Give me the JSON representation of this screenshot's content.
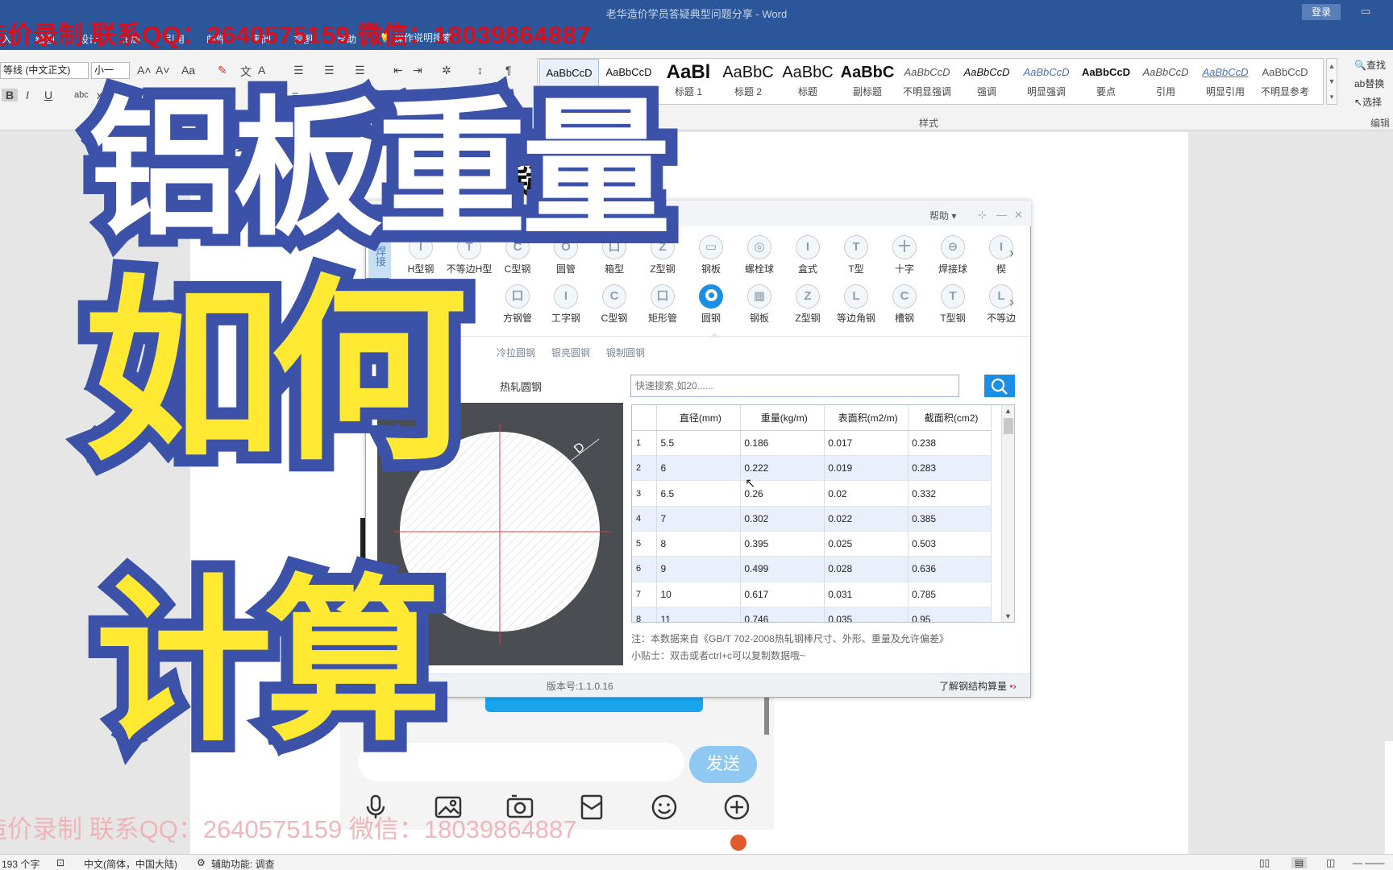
{
  "word": {
    "doc_title": "老华造价学员答疑典型问题分享  -  Word",
    "login": "登录",
    "tabs": [
      "入",
      "绘图",
      "设计",
      "布局",
      "引用",
      "邮件",
      "审阅",
      "视图",
      "帮助"
    ],
    "tell_me": "操作说明搜索",
    "font_name": "等线 (中文正文)",
    "font_size": "小一",
    "styles": [
      {
        "preview": "AaBbCcD",
        "name": "正文"
      },
      {
        "preview": "AaBbCcD",
        "name": "无间隔"
      },
      {
        "preview": "AaBl",
        "name": "标题 1"
      },
      {
        "preview": "AaBbC",
        "name": "标题 2"
      },
      {
        "preview": "AaBbC",
        "name": "标题"
      },
      {
        "preview": "AaBbC",
        "name": "副标题"
      },
      {
        "preview": "AaBbCcD",
        "name": "不明显强调"
      },
      {
        "preview": "AaBbCcD",
        "name": "强调"
      },
      {
        "preview": "AaBbCcD",
        "name": "明显强调"
      },
      {
        "preview": "AaBbCcD",
        "name": "要点"
      },
      {
        "preview": "AaBbCcD",
        "name": "引用"
      },
      {
        "preview": "AaBbCcD",
        "name": "明显引用"
      },
      {
        "preview": "AaBbCcD",
        "name": "不明显参考"
      }
    ],
    "styles_label": "样式",
    "find": "查找",
    "replace": "替换",
    "select": "选择",
    "edit_label": "编辑",
    "page_heading": "造 疑",
    "status": {
      "word_count": "193 个字",
      "language": "中文(简体，中国大陆)",
      "accessibility": "辅助功能: 调查"
    }
  },
  "watermark": {
    "top": "造价录制 联系QQ：2640575159 微信：18039864887",
    "bottom": "造价录制 联系QQ：2640575159 微信：18039864887"
  },
  "overlay": {
    "line1": "铝板重量",
    "line2": "如何",
    "line3": "计算"
  },
  "tool": {
    "header_faint": "公有",
    "help": "帮助",
    "left_tab": "焊接",
    "row1": [
      {
        "label": "H型钢",
        "icon": "I"
      },
      {
        "label": "不等边H型",
        "icon": "T"
      },
      {
        "label": "C型钢",
        "icon": "C"
      },
      {
        "label": "圆管",
        "icon": "O"
      },
      {
        "label": "箱型",
        "icon": "口"
      },
      {
        "label": "Z型钢",
        "icon": "Z"
      },
      {
        "label": "钢板",
        "icon": "▭"
      },
      {
        "label": "螺栓球",
        "icon": "◎"
      },
      {
        "label": "盒式",
        "icon": "I"
      },
      {
        "label": "T型",
        "icon": "T"
      },
      {
        "label": "十字",
        "icon": "十"
      },
      {
        "label": "焊接球",
        "icon": "⊖"
      },
      {
        "label": "楔",
        "icon": "I"
      }
    ],
    "row2": [
      {
        "label": "",
        "icon": ""
      },
      {
        "label": "",
        "icon": ""
      },
      {
        "label": "方钢管",
        "icon": "口"
      },
      {
        "label": "工字钢",
        "icon": "I"
      },
      {
        "label": "C型钢",
        "icon": "C"
      },
      {
        "label": "矩形管",
        "icon": "口"
      },
      {
        "label": "圆钢",
        "icon": "●"
      },
      {
        "label": "钢板",
        "icon": "▦"
      },
      {
        "label": "Z型钢",
        "icon": "Z"
      },
      {
        "label": "等边角钢",
        "icon": "L"
      },
      {
        "label": "槽钢",
        "icon": "C"
      },
      {
        "label": "T型钢",
        "icon": "T"
      },
      {
        "label": "不等边",
        "icon": "L"
      }
    ],
    "subtabs": [
      "冷拉圆钢",
      "银亮圆钢",
      "锻制圆钢"
    ],
    "pane_title": "热轧圆钢",
    "search_placeholder": "快速搜索,如20......",
    "table": {
      "headers": [
        "直径(mm)",
        "重量(kg/m)",
        "表面积(m2/m)",
        "截面积(cm2)"
      ],
      "rows": [
        [
          "1",
          "5.5",
          "0.186",
          "0.017",
          "0.238"
        ],
        [
          "2",
          "6",
          "0.222",
          "0.019",
          "0.283"
        ],
        [
          "3",
          "6.5",
          "0.26",
          "0.02",
          "0.332"
        ],
        [
          "4",
          "7",
          "0.302",
          "0.022",
          "0.385"
        ],
        [
          "5",
          "8",
          "0.395",
          "0.025",
          "0.503"
        ],
        [
          "6",
          "9",
          "0.499",
          "0.028",
          "0.636"
        ],
        [
          "7",
          "10",
          "0.617",
          "0.031",
          "0.785"
        ],
        [
          "8",
          "11",
          "0.746",
          "0.035",
          "0.95"
        ]
      ]
    },
    "note": "注：本数据来自《GB/T 702-2008热轧钢棒尺寸、外形、重量及允许偏差》",
    "tip": "小贴士：双击或者ctrl+c可以复制数据哦~",
    "version": "版本号:1.1.0.16",
    "learn": "了解钢结构算量",
    "diagram_label": "D"
  },
  "chat": {
    "send": "发送"
  },
  "colors": {
    "word_blue": "#2b579a",
    "accent_blue": "#1a8fe3",
    "overlay_outline": "#3c52a9",
    "overlay_yellow": "#ffe933",
    "watermark_red": "#d90f1c"
  }
}
